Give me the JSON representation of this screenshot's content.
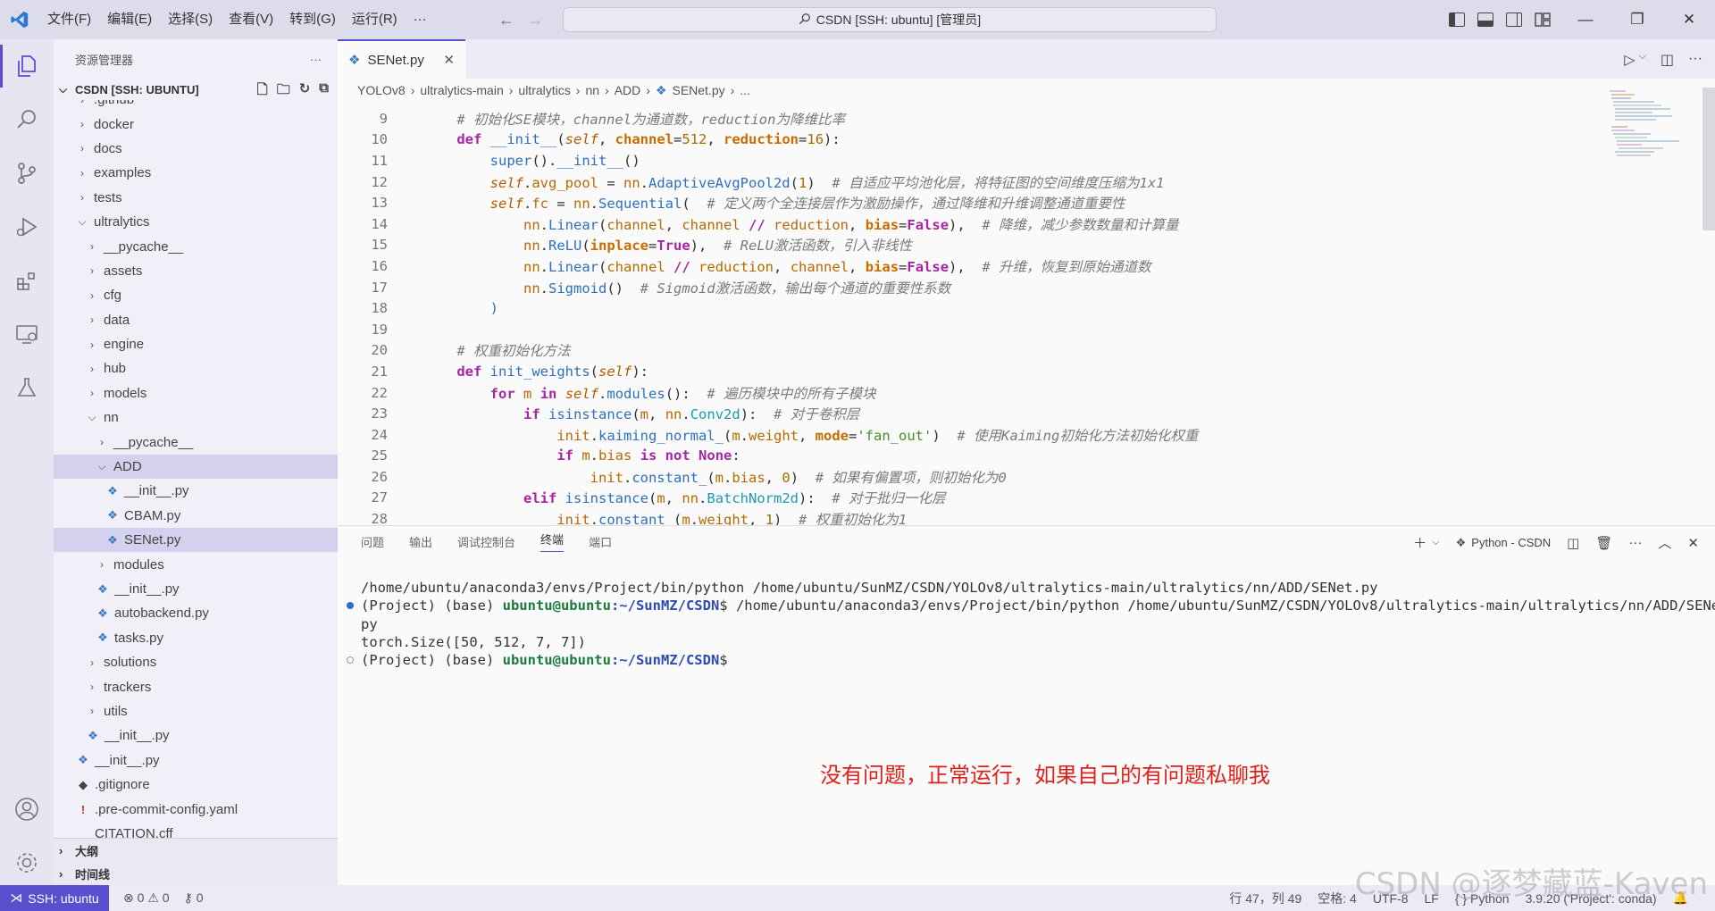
{
  "titlebar": {
    "menu": [
      "文件(F)",
      "编辑(E)",
      "选择(S)",
      "查看(V)",
      "转到(G)",
      "运行(R)",
      "···"
    ],
    "search_text": "CSDN [SSH: ubuntu] [管理员]"
  },
  "sidebar": {
    "title": "资源管理器",
    "more": "···",
    "root_section": "CSDN [SSH: UBUNTU]",
    "tree": [
      {
        "label": ".github",
        "depth": 1,
        "type": "folder",
        "open": false
      },
      {
        "label": "docker",
        "depth": 1,
        "type": "folder",
        "open": false
      },
      {
        "label": "docs",
        "depth": 1,
        "type": "folder",
        "open": false
      },
      {
        "label": "examples",
        "depth": 1,
        "type": "folder",
        "open": false
      },
      {
        "label": "tests",
        "depth": 1,
        "type": "folder",
        "open": false
      },
      {
        "label": "ultralytics",
        "depth": 1,
        "type": "folder",
        "open": true
      },
      {
        "label": "__pycache__",
        "depth": 2,
        "type": "folder",
        "open": false
      },
      {
        "label": "assets",
        "depth": 2,
        "type": "folder",
        "open": false
      },
      {
        "label": "cfg",
        "depth": 2,
        "type": "folder",
        "open": false
      },
      {
        "label": "data",
        "depth": 2,
        "type": "folder",
        "open": false
      },
      {
        "label": "engine",
        "depth": 2,
        "type": "folder",
        "open": false
      },
      {
        "label": "hub",
        "depth": 2,
        "type": "folder",
        "open": false
      },
      {
        "label": "models",
        "depth": 2,
        "type": "folder",
        "open": false
      },
      {
        "label": "nn",
        "depth": 2,
        "type": "folder",
        "open": true
      },
      {
        "label": "__pycache__",
        "depth": 3,
        "type": "folder",
        "open": false
      },
      {
        "label": "ADD",
        "depth": 3,
        "type": "folder",
        "open": true,
        "selected": true
      },
      {
        "label": "__init__.py",
        "depth": 4,
        "type": "py"
      },
      {
        "label": "CBAM.py",
        "depth": 4,
        "type": "py"
      },
      {
        "label": "SENet.py",
        "depth": 4,
        "type": "py",
        "selected": true
      },
      {
        "label": "modules",
        "depth": 3,
        "type": "folder",
        "open": false
      },
      {
        "label": "__init__.py",
        "depth": 3,
        "type": "py"
      },
      {
        "label": "autobackend.py",
        "depth": 3,
        "type": "py"
      },
      {
        "label": "tasks.py",
        "depth": 3,
        "type": "py"
      },
      {
        "label": "solutions",
        "depth": 2,
        "type": "folder",
        "open": false
      },
      {
        "label": "trackers",
        "depth": 2,
        "type": "folder",
        "open": false
      },
      {
        "label": "utils",
        "depth": 2,
        "type": "folder",
        "open": false
      },
      {
        "label": "__init__.py",
        "depth": 2,
        "type": "py"
      },
      {
        "label": "__init__.py",
        "depth": 1,
        "type": "py"
      },
      {
        "label": ".gitignore",
        "depth": 1,
        "type": "git"
      },
      {
        "label": ".pre-commit-config.yaml",
        "depth": 1,
        "type": "yaml"
      },
      {
        "label": "CITATION.cff",
        "depth": 1,
        "type": "file"
      }
    ],
    "outline_label": "大纲",
    "timeline_label": "时间线"
  },
  "editor": {
    "tab_label": "SENet.py",
    "breadcrumb": [
      "YOLOv8",
      "ultralytics-main",
      "ultralytics",
      "nn",
      "ADD",
      "SENet.py",
      "..."
    ],
    "line_numbers": [
      "9",
      "10",
      "11",
      "12",
      "13",
      "14",
      "15",
      "16",
      "17",
      "18",
      "19",
      "20",
      "21",
      "22",
      "23",
      "24",
      "25",
      "26",
      "27",
      "28"
    ]
  },
  "panel": {
    "tabs": [
      "问题",
      "输出",
      "调试控制台",
      "终端",
      "端口"
    ],
    "active_tab": "终端",
    "terminal_profile": "Python - CSDN",
    "terminal": {
      "line1": "/home/ubuntu/anaconda3/envs/Project/bin/python /home/ubuntu/SunMZ/CSDN/YOLOv8/ultralytics-main/ultralytics/nn/ADD/SENet.py",
      "prefix": "(Project) (base) ",
      "user": "ubuntu@ubuntu",
      "path": ":~/SunMZ/CSDN",
      "cmd": "$ /home/ubuntu/anaconda3/envs/Project/bin/python /home/ubuntu/SunMZ/CSDN/YOLOv8/ultralytics-main/ultralytics/nn/ADD/SENet.",
      "cmd_wrap": "py",
      "output": "torch.Size([50, 512, 7, 7])",
      "prompt_end": "$"
    },
    "annotation": "没有问题，正常运行，如果自己的有问题私聊我"
  },
  "statusbar": {
    "remote": "SSH: ubuntu",
    "errors": "0",
    "warnings": "0",
    "ports": "0",
    "position": "行 47，列 49",
    "spaces": "空格: 4",
    "encoding": "UTF-8",
    "eol": "LF",
    "language": "Python",
    "interpreter": "3.9.20 ('Project': conda)"
  },
  "watermark": "CSDN @逐梦藏蓝-Kaven"
}
